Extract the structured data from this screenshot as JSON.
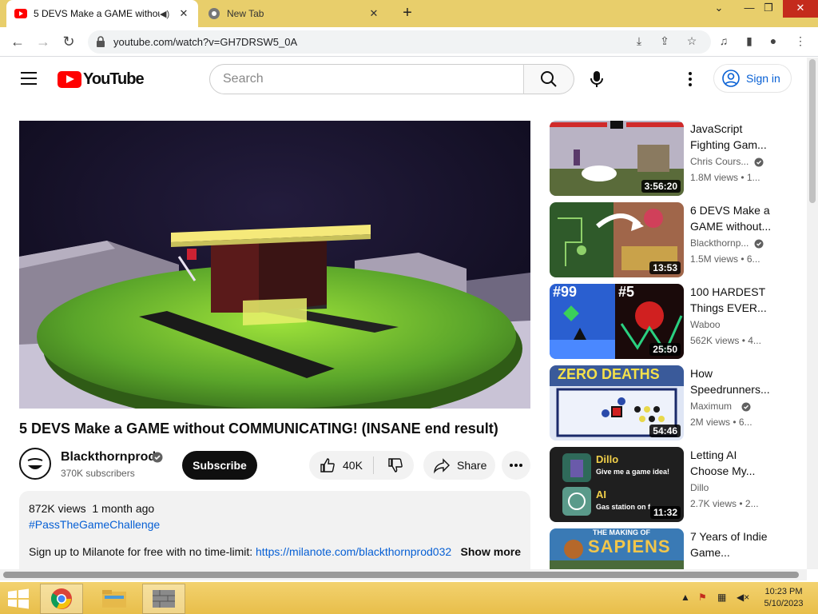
{
  "browser": {
    "tabs": [
      {
        "title": "5 DEVS Make a GAME withou",
        "active": true
      },
      {
        "title": "New Tab",
        "active": false
      }
    ],
    "new_tab": "+",
    "url": "youtube.com/watch?v=GH7DRSW5_0A"
  },
  "youtube": {
    "logo_text": "YouTube",
    "search_placeholder": "Search",
    "signin_label": "Sign in"
  },
  "video": {
    "title": "5 DEVS Make a GAME without COMMUNICATING! (INSANE end result)",
    "channel": "Blackthornprod",
    "subscribers": "370K subscribers",
    "subscribe_label": "Subscribe",
    "likes": "40K",
    "share_label": "Share",
    "views": "872K views",
    "age": "1 month ago",
    "hashtag": "#PassTheGameChallenge",
    "description_text": "Sign up to Milanote for free with no time-limit: ",
    "description_link": "https://milanote.com/blackthornprod032",
    "show_more": "Show more"
  },
  "recommendations": [
    {
      "title": "JavaScript Fighting Gam...",
      "channel": "Chris Cours...",
      "verified": true,
      "meta": "1.8M views  •  1...",
      "duration": "3:56:20"
    },
    {
      "title": "6 DEVS Make a GAME without...",
      "channel": "Blackthornp...",
      "verified": true,
      "meta": "1.5M views  •  6...",
      "duration": "13:53"
    },
    {
      "title": "100 HARDEST Things EVER...",
      "channel": "Waboo",
      "verified": false,
      "meta": "562K views  •  4...",
      "duration": "25:50"
    },
    {
      "title": "How Speedrunners...",
      "channel": "Maximum",
      "verified": true,
      "meta": "2M views  •  6...",
      "duration": "54:46"
    },
    {
      "title": "Letting AI Choose My...",
      "channel": "Dillo",
      "verified": false,
      "meta": "2.7K views  •  2...",
      "duration": "11:32"
    },
    {
      "title": "7 Years of Indie Game...",
      "channel": "",
      "verified": false,
      "meta": "",
      "duration": ""
    }
  ],
  "thumb_text": {
    "t3_left": "#99",
    "t3_right": "#5",
    "t4_banner": "ZERO DEATHS",
    "t5_top": "Dillo",
    "t5_top_sub": "Give me a game idea!",
    "t5_bottom": "AI",
    "t5_bottom_sub": "Gas station on f",
    "t6_small": "THE MAKING OF",
    "t6_big": "SAPIENS"
  },
  "taskbar": {
    "time": "10:23 PM",
    "date": "5/10/2023"
  },
  "colors": {
    "taskbar": "#e8be4a",
    "youtube_red": "#ff0000",
    "link_blue": "#065fd4"
  }
}
